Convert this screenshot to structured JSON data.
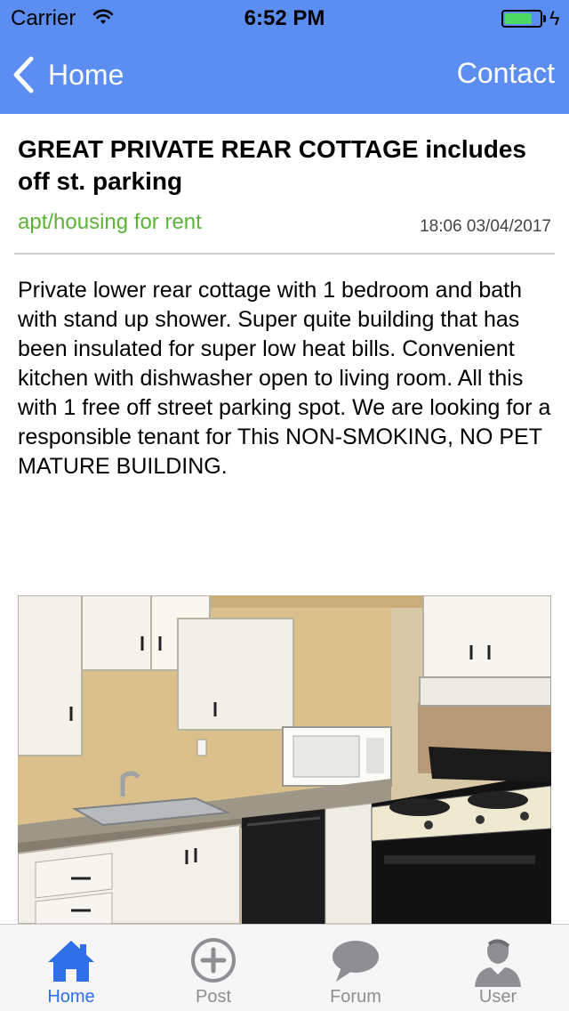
{
  "status_bar": {
    "carrier": "Carrier",
    "time": "6:52 PM",
    "battery_level": 0.8,
    "charging_icon": "bolt-icon"
  },
  "nav_bar": {
    "back_label": "Home",
    "back_icon": "chevron-left-icon",
    "right_label": "Contact",
    "background": "#5b8ef0"
  },
  "post": {
    "title": "GREAT PRIVATE REAR COTTAGE includes off st. parking",
    "category": "apt/housing for rent",
    "category_color": "#5cb336",
    "timestamp": "18:06 03/04/2017",
    "description": "Private lower rear cottage with 1 bedroom and bath with stand up shower. Super quite building that has been insulated for super low heat bills. Convenient kitchen with dishwasher open to living room. All this with 1 free off street parking spot. We are looking for a responsible tenant for This NON-SMOKING, NO PET MATURE BUILDING."
  },
  "tab_bar": {
    "active_color": "#2f6fe8",
    "inactive_color": "#8e8e93",
    "tabs": [
      {
        "label": "Home",
        "icon": "home-icon",
        "active": true
      },
      {
        "label": "Post",
        "icon": "plus-circle-icon",
        "active": false
      },
      {
        "label": "Forum",
        "icon": "chat-bubble-icon",
        "active": false
      },
      {
        "label": "User",
        "icon": "user-icon",
        "active": false
      }
    ]
  }
}
